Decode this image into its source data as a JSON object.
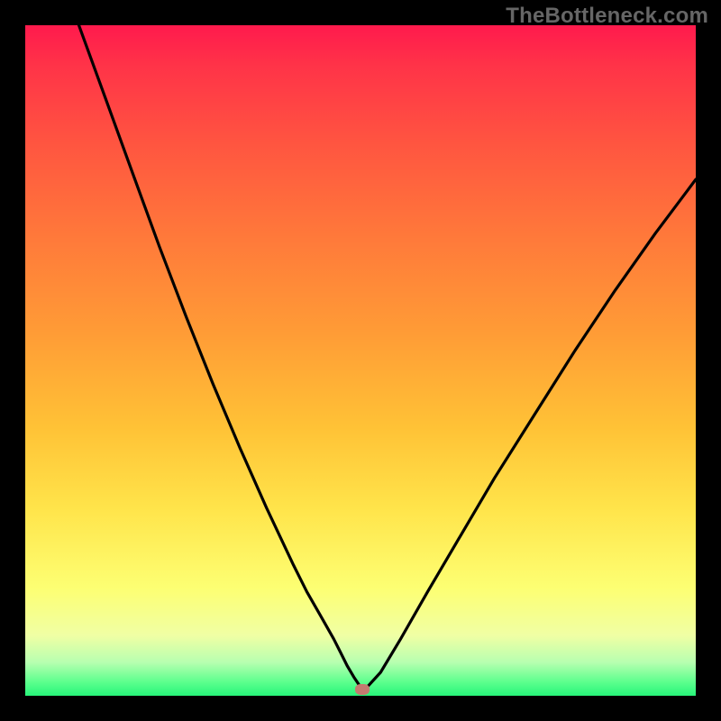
{
  "watermark": "TheBottleneck.com",
  "chart_data": {
    "type": "line",
    "title": "",
    "xlabel": "",
    "ylabel": "",
    "xlim": [
      0,
      100
    ],
    "ylim": [
      0,
      100
    ],
    "note": "Percent-of-plot coordinates; y=0 at bottom (green), y=100 at top (red). V-shaped bottleneck curve. Values estimated from pixels.",
    "series": [
      {
        "name": "bottleneck-curve",
        "x": [
          8,
          12,
          16,
          20,
          24,
          28,
          32,
          36,
          40,
          42,
          44,
          46,
          47,
          48,
          49,
          50,
          51,
          53,
          56,
          60,
          65,
          70,
          76,
          82,
          88,
          94,
          100
        ],
        "y": [
          100,
          89,
          78,
          67,
          56.5,
          46.5,
          37,
          28,
          19.5,
          15.5,
          12,
          8.5,
          6.5,
          4.5,
          2.8,
          1.3,
          1.3,
          3.5,
          8.5,
          15.5,
          24,
          32.5,
          42,
          51.5,
          60.5,
          69,
          77
        ]
      }
    ],
    "marker": {
      "x": 50.3,
      "y": 1.0
    },
    "gradient_stops": [
      {
        "pct": 0,
        "color": "#ff1a4d"
      },
      {
        "pct": 18,
        "color": "#ff5640"
      },
      {
        "pct": 46,
        "color": "#ff9c36"
      },
      {
        "pct": 72,
        "color": "#ffe44a"
      },
      {
        "pct": 91,
        "color": "#f0ffa4"
      },
      {
        "pct": 100,
        "color": "#27f57a"
      }
    ]
  }
}
